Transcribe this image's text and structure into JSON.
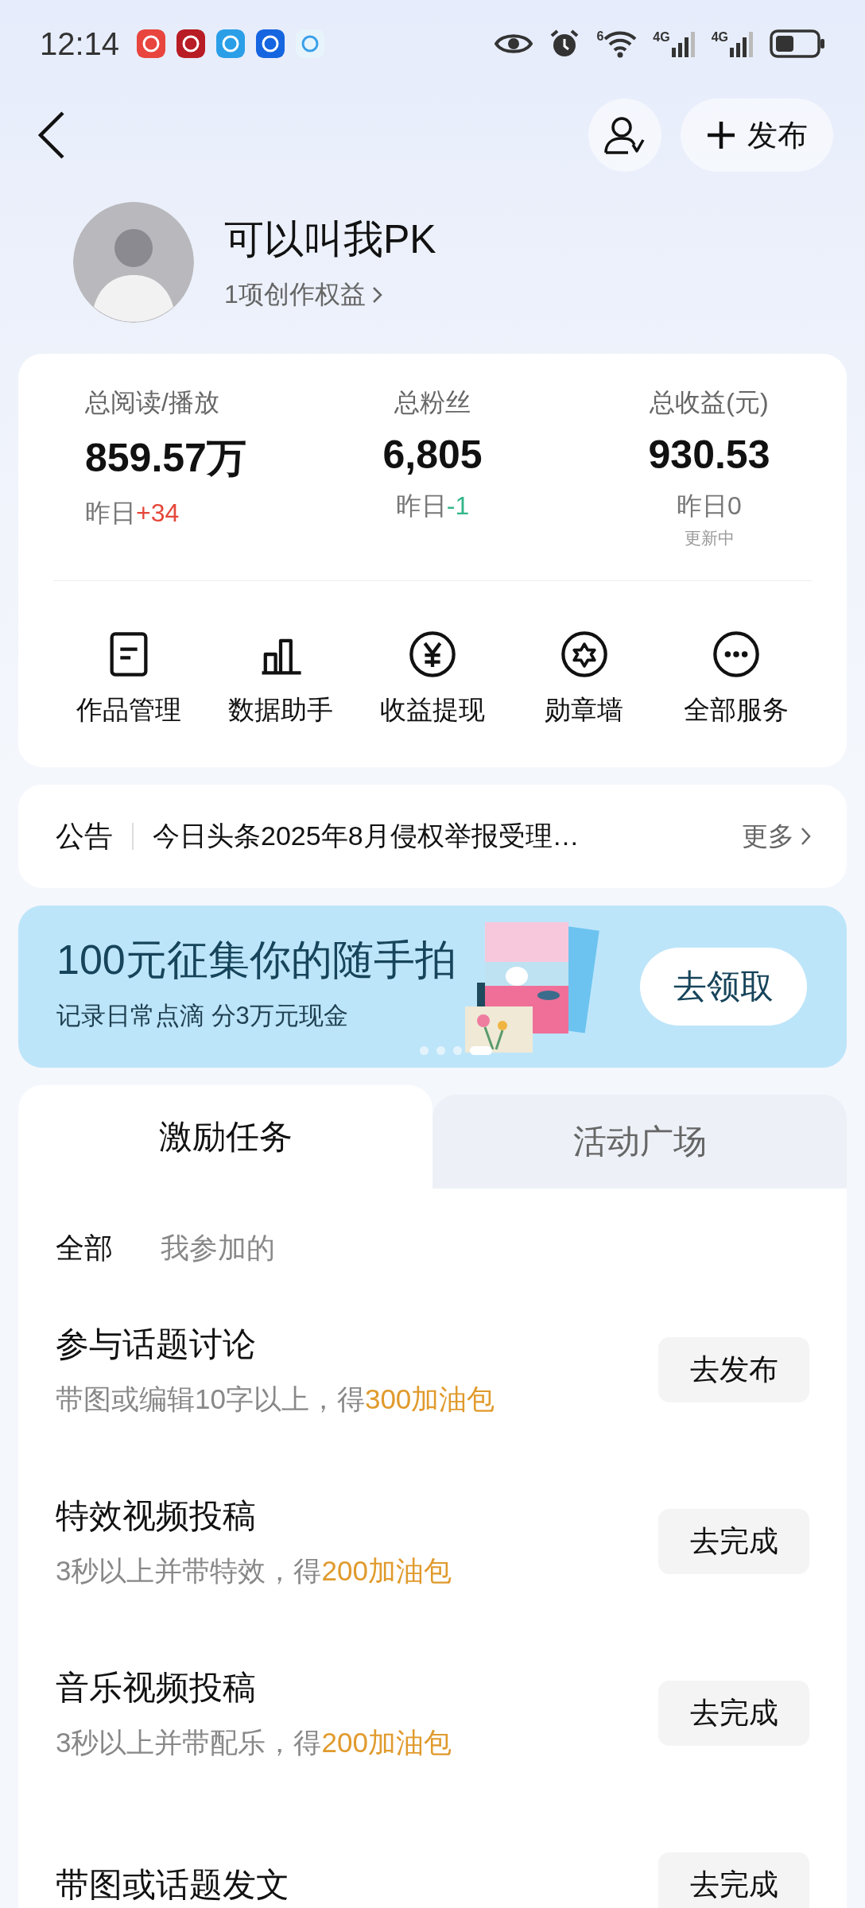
{
  "status_bar": {
    "time": "12:14",
    "wifi_label": "6",
    "signals": [
      {
        "label": "4G"
      },
      {
        "label": "4G"
      }
    ]
  },
  "header": {
    "publish_button": "发布"
  },
  "profile": {
    "name": "可以叫我PK",
    "benefits": "1项创作权益"
  },
  "stats": [
    {
      "label": "总阅读/播放",
      "value": "859.57万",
      "delta_prefix": "昨日",
      "delta": "+34",
      "color": "#e5473a"
    },
    {
      "label": "总粉丝",
      "value": "6,805",
      "delta_prefix": "昨日",
      "delta": "-1",
      "color": "#33b58a"
    },
    {
      "label": "总收益(元)",
      "value": "930.53",
      "delta_prefix": "昨日",
      "delta": "0",
      "color": "#777777",
      "note": "更新中"
    }
  ],
  "services": [
    {
      "label": "作品管理",
      "kind": "document"
    },
    {
      "label": "数据助手",
      "kind": "chart"
    },
    {
      "label": "收益提现",
      "kind": "yen"
    },
    {
      "label": "勋章墙",
      "kind": "badge"
    },
    {
      "label": "全部服务",
      "kind": "more"
    }
  ],
  "notice": {
    "label": "公告",
    "text": "今日头条2025年8月侵权举报受理…",
    "more": "更多"
  },
  "banner": {
    "title": "100元征集你的随手拍",
    "subtitle": "记录日常点滴 分3万元现金",
    "button": "去领取",
    "pages": [
      {
        "selected": false
      },
      {
        "selected": false
      },
      {
        "selected": false
      },
      {
        "selected": true
      }
    ]
  },
  "tabs": [
    {
      "label": "激励任务",
      "selected": true
    },
    {
      "label": "活动广场",
      "selected": false
    }
  ],
  "filters": [
    {
      "label": "全部",
      "selected": true
    },
    {
      "label": "我参加的",
      "selected": false
    }
  ],
  "tasks": [
    {
      "title": "参与话题讨论",
      "description": "带图或编辑10字以上，得",
      "reward": "300加油包",
      "button": "去发布"
    },
    {
      "title": "特效视频投稿",
      "description": "3秒以上并带特效，得",
      "reward": "200加油包",
      "button": "去完成"
    },
    {
      "title": "音乐视频投稿",
      "description": "3秒以上并带配乐，得",
      "reward": "200加油包",
      "button": "去完成"
    },
    {
      "title": "带图或话题发文",
      "button": "去完成"
    }
  ]
}
